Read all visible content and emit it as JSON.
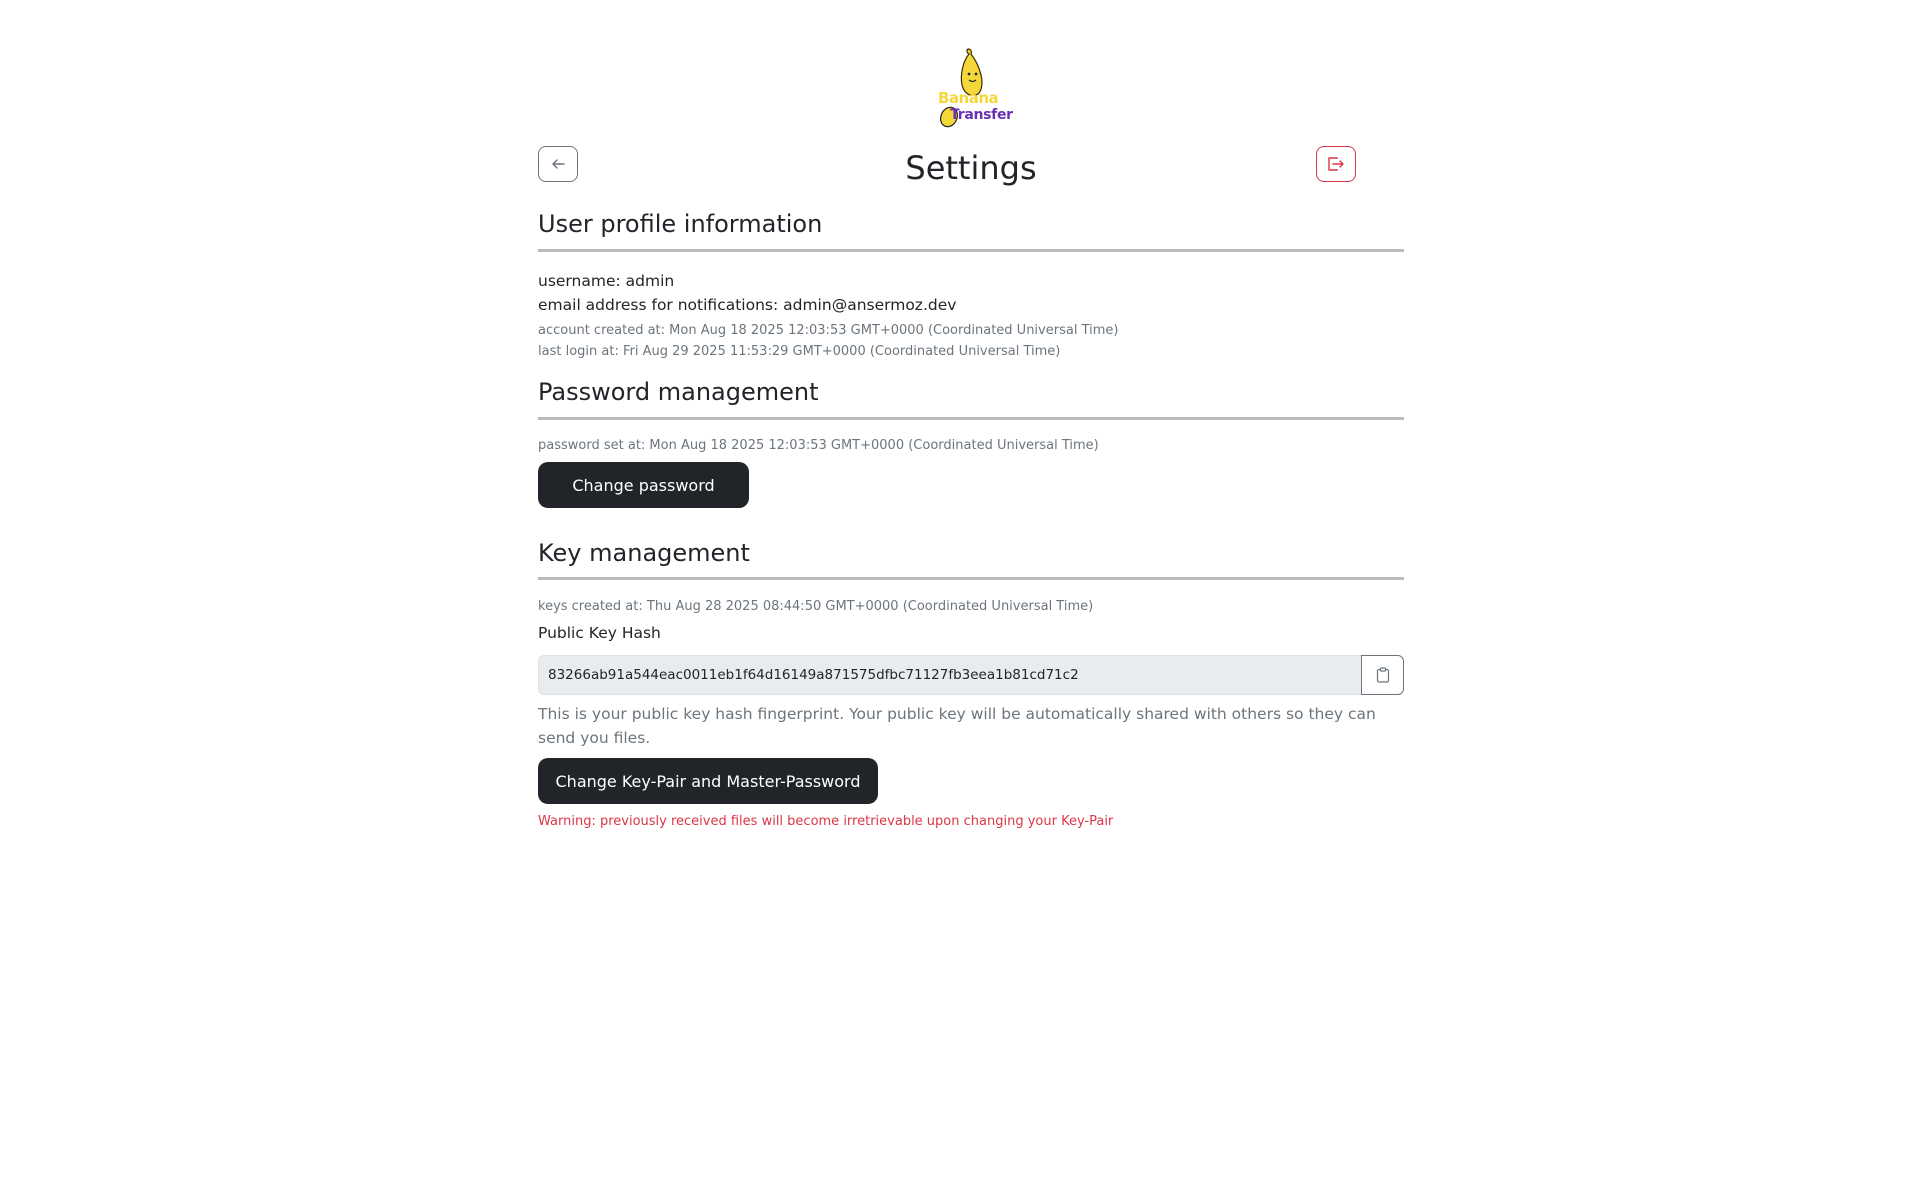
{
  "logo": {
    "word1": "Banana",
    "word2": "Transfer"
  },
  "header": {
    "title": "Settings",
    "back_icon": "arrow-left-icon",
    "logout_icon": "logout-icon"
  },
  "profile": {
    "title": "User profile information",
    "username": "username: admin",
    "email": "email address for notifications: admin@ansermoz.dev",
    "created": "account created at: Mon Aug 18 2025 12:03:53 GMT+0000 (Coordinated Universal Time)",
    "last_login": "last login at: Fri Aug 29 2025 11:53:29 GMT+0000 (Coordinated Universal Time)"
  },
  "password": {
    "title": "Password management",
    "set_at": "password set at: Mon Aug 18 2025 12:03:53 GMT+0000 (Coordinated Universal Time)",
    "button": "Change password"
  },
  "keys": {
    "title": "Key management",
    "created": "keys created at: Thu Aug 28 2025 08:44:50 GMT+0000 (Coordinated Universal Time)",
    "hash_label": "Public Key Hash",
    "hash_value": "83266ab91a544eac0011eb1f64d16149a871575dfbc71127fb3eea1b81cd71c2",
    "copy_icon": "clipboard-icon",
    "help": "This is your public key hash fingerprint. Your public key will be automatically shared with others so they can send you files.",
    "button": "Change Key-Pair and Master-Password",
    "warning": "Warning: previously received files will become irretrievable upon changing your Key-Pair"
  },
  "colors": {
    "primary_dark": "#212529",
    "danger": "#dc3545",
    "muted": "#6c757d",
    "input_bg": "#e9ecef",
    "banana": "#f4d83a",
    "brand_purple": "#6b2fb3"
  }
}
